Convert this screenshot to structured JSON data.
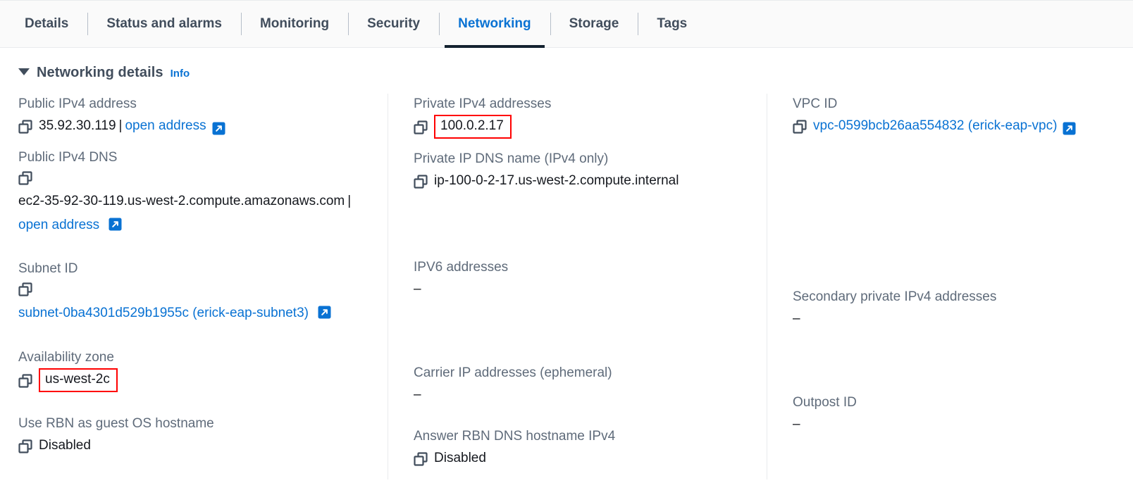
{
  "tabs": [
    {
      "label": "Details",
      "active": false
    },
    {
      "label": "Status and alarms",
      "active": false
    },
    {
      "label": "Monitoring",
      "active": false
    },
    {
      "label": "Security",
      "active": false
    },
    {
      "label": "Networking",
      "active": true
    },
    {
      "label": "Storage",
      "active": false
    },
    {
      "label": "Tags",
      "active": false
    }
  ],
  "section": {
    "title": "Networking details",
    "info_label": "Info"
  },
  "colors": {
    "link": "#0972d3",
    "label": "#5f6b7a",
    "value": "#16191f",
    "highlight": "#ff0000",
    "active_tab_underline": "#13222f"
  },
  "columns": {
    "left": {
      "public_ipv4_address": {
        "label": "Public IPv4 address",
        "value": "35.92.30.119",
        "separator": "|",
        "link_label": "open address"
      },
      "public_ipv4_dns": {
        "label": "Public IPv4 DNS",
        "value": "ec2-35-92-30-119.us-west-2.compute.amazonaws.com",
        "separator": "|",
        "link_label": "open address"
      },
      "subnet_id": {
        "label": "Subnet ID",
        "link_label": "subnet-0ba4301d529b1955c (erick-eap-subnet3)"
      },
      "availability_zone": {
        "label": "Availability zone",
        "value": "us-west-2c",
        "highlighted": true
      },
      "use_rbn_as_guest_os_hostname": {
        "label": "Use RBN as guest OS hostname",
        "value": "Disabled"
      }
    },
    "middle": {
      "private_ipv4_addresses": {
        "label": "Private IPv4 addresses",
        "value": "100.0.2.17",
        "highlighted": true
      },
      "private_ip_dns_name": {
        "label": "Private IP DNS name (IPv4 only)",
        "value": "ip-100-0-2-17.us-west-2.compute.internal"
      },
      "ipv6_addresses": {
        "label": "IPV6 addresses",
        "value": "–"
      },
      "carrier_ip_addresses": {
        "label": "Carrier IP addresses (ephemeral)",
        "value": "–"
      },
      "answer_rbn_dns_hostname_ipv4": {
        "label": "Answer RBN DNS hostname IPv4",
        "value": "Disabled"
      }
    },
    "right": {
      "vpc_id": {
        "label": "VPC ID",
        "link_label": "vpc-0599bcb26aa554832 (erick-eap-vpc)"
      },
      "secondary_private_ipv4_addresses": {
        "label": "Secondary private IPv4 addresses",
        "value": "–"
      },
      "outpost_id": {
        "label": "Outpost ID",
        "value": "–"
      }
    }
  }
}
